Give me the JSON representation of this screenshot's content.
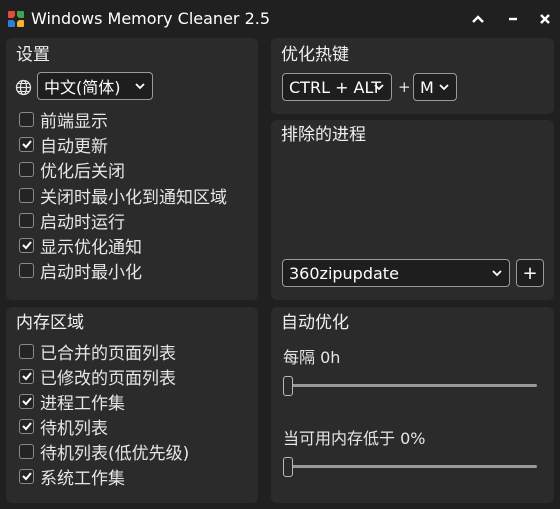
{
  "window": {
    "title": "Windows Memory Cleaner 2.5",
    "icons": {
      "app": "app-logo-icon",
      "collapse": "chevron-up-icon",
      "minimize": "minimize-icon",
      "close": "close-icon"
    }
  },
  "settings": {
    "title": "设置",
    "language_icon": "globe-icon",
    "language_selected": "中文(简体)",
    "options": [
      {
        "label": "前端显示",
        "checked": false
      },
      {
        "label": "自动更新",
        "checked": true
      },
      {
        "label": "优化后关闭",
        "checked": false
      },
      {
        "label": "关闭时最小化到通知区域",
        "checked": false
      },
      {
        "label": "启动时运行",
        "checked": false
      },
      {
        "label": "显示优化通知",
        "checked": true
      },
      {
        "label": "启动时最小化",
        "checked": false
      }
    ]
  },
  "hotkey": {
    "title": "优化热键",
    "modifier_selected": "CTRL + ALT",
    "plus": "+",
    "key_selected": "M"
  },
  "excluded": {
    "title": "排除的进程",
    "process_selected": "360zipupdate",
    "add_label": "+"
  },
  "memory_areas": {
    "title": "内存区域",
    "options": [
      {
        "label": "已合并的页面列表",
        "checked": false
      },
      {
        "label": "已修改的页面列表",
        "checked": true
      },
      {
        "label": "进程工作集",
        "checked": true
      },
      {
        "label": "待机列表",
        "checked": true
      },
      {
        "label": "待机列表(低优先级)",
        "checked": false
      },
      {
        "label": "系统工作集",
        "checked": true
      }
    ]
  },
  "auto_optimize": {
    "title": "自动优化",
    "interval_label": "每隔 0h",
    "interval_value": 0,
    "memory_label": "当可用内存低于 0%",
    "memory_value": 0
  },
  "colors": {
    "background": "#202020",
    "panel": "#2b2b2b",
    "text": "#e8e8e8"
  }
}
